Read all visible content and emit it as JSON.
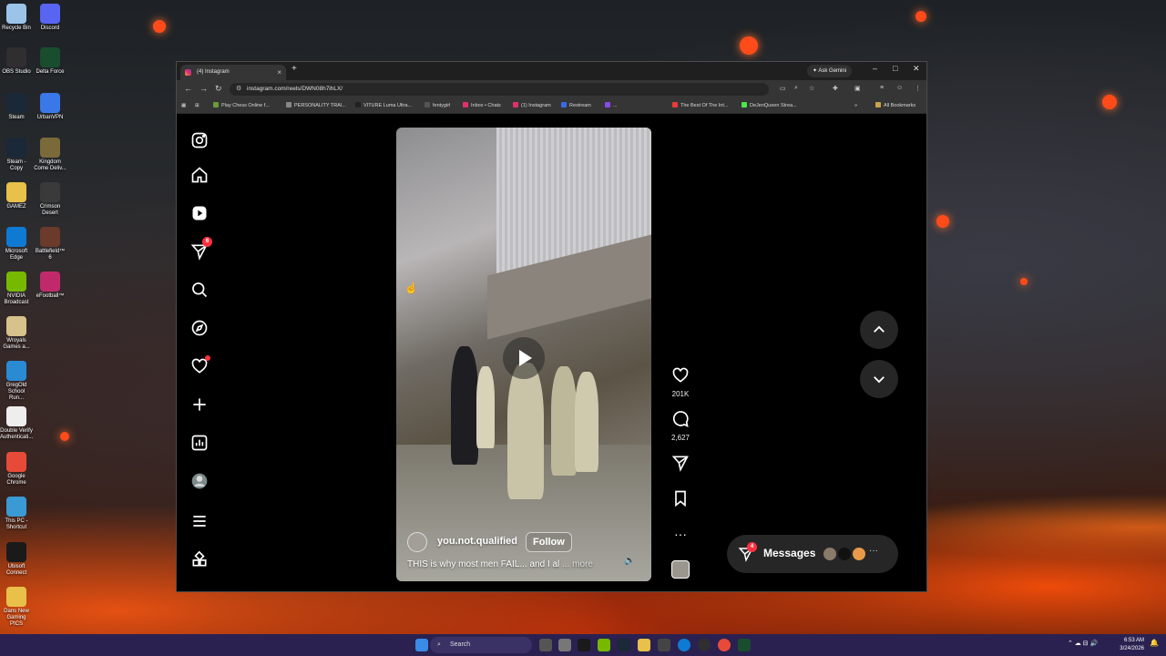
{
  "desktop": {
    "icons": [
      {
        "label": "Recycle Bin",
        "color": "#9cc4e8"
      },
      {
        "label": "Discord",
        "color": "#5865f2"
      },
      {
        "label": "OBS Studio",
        "color": "#302e31"
      },
      {
        "label": "Delta Force",
        "color": "#1a4d2e"
      },
      {
        "label": "Steam",
        "color": "#1b2838"
      },
      {
        "label": "UrbanVPN",
        "color": "#3b78e7"
      },
      {
        "label": "Steam - Copy",
        "color": "#1b2838"
      },
      {
        "label": "Kingdom Come Deliv...",
        "color": "#7a6a3a"
      },
      {
        "label": "GAMEZ",
        "color": "#e8c04a"
      },
      {
        "label": "Crimson Desert",
        "color": "#3a3a3a"
      },
      {
        "label": "Microsoft Edge",
        "color": "#0f7ad4"
      },
      {
        "label": "Battlefield™ 6",
        "color": "#6a3a2a"
      },
      {
        "label": "NVIDIA Broadcast",
        "color": "#76b900"
      },
      {
        "label": "eFootball™",
        "color": "#c02a6a"
      },
      {
        "label": "Wroyals Games a...",
        "color": "#d6c28a"
      },
      {
        "label": "GregOld School Run...",
        "color": "#2a8ad4"
      },
      {
        "label": "Double Verify Authenticati...",
        "color": "#eeeeee"
      },
      {
        "label": "Google Chrome",
        "color": "#e84a3a"
      },
      {
        "label": "This PC - Shortcut",
        "color": "#3a9ad4"
      },
      {
        "label": "Ubisoft Connect",
        "color": "#1a1a1a"
      },
      {
        "label": "Dans New Gaming PICS",
        "color": "#e8c04a"
      }
    ]
  },
  "browser": {
    "tab_title": "(4) Instagram",
    "ask_gemini": "Ask Gemini",
    "url": "instagram.com/reels/DWN08h7ihLX/",
    "bookmarks": [
      {
        "label": "Play Chess Online f...",
        "color": "#6a9a3a"
      },
      {
        "label": "PERSONALITY TRAI...",
        "color": "#888888"
      },
      {
        "label": "VITURE Luma Ultra...",
        "color": "#222222"
      },
      {
        "label": "fentygirl",
        "color": "#555555"
      },
      {
        "label": "Inbox • Chats",
        "color": "#e1306c"
      },
      {
        "label": "(1) Instagram",
        "color": "#e1306c"
      },
      {
        "label": "Restream",
        "color": "#3a6ae8"
      },
      {
        "label": "...",
        "color": "#8a4ae8"
      },
      {
        "label": "The Best Of The Int...",
        "color": "#e83a3a"
      },
      {
        "label": "DeJenQueen Strea...",
        "color": "#4ae84a"
      }
    ],
    "all_bookmarks": "All Bookmarks"
  },
  "instagram": {
    "nav_badge": "6",
    "reel": {
      "username": "you.not.qualified",
      "follow_label": "Follow",
      "caption": "THIS is why most men FAIL... and I al",
      "more_label": "... more"
    },
    "actions": {
      "likes": "201K",
      "comments": "2,627"
    },
    "messages": {
      "label": "Messages",
      "badge": "4"
    }
  },
  "taskbar": {
    "search_placeholder": "Search",
    "time": "6:53 AM",
    "date": "3/24/2026"
  }
}
